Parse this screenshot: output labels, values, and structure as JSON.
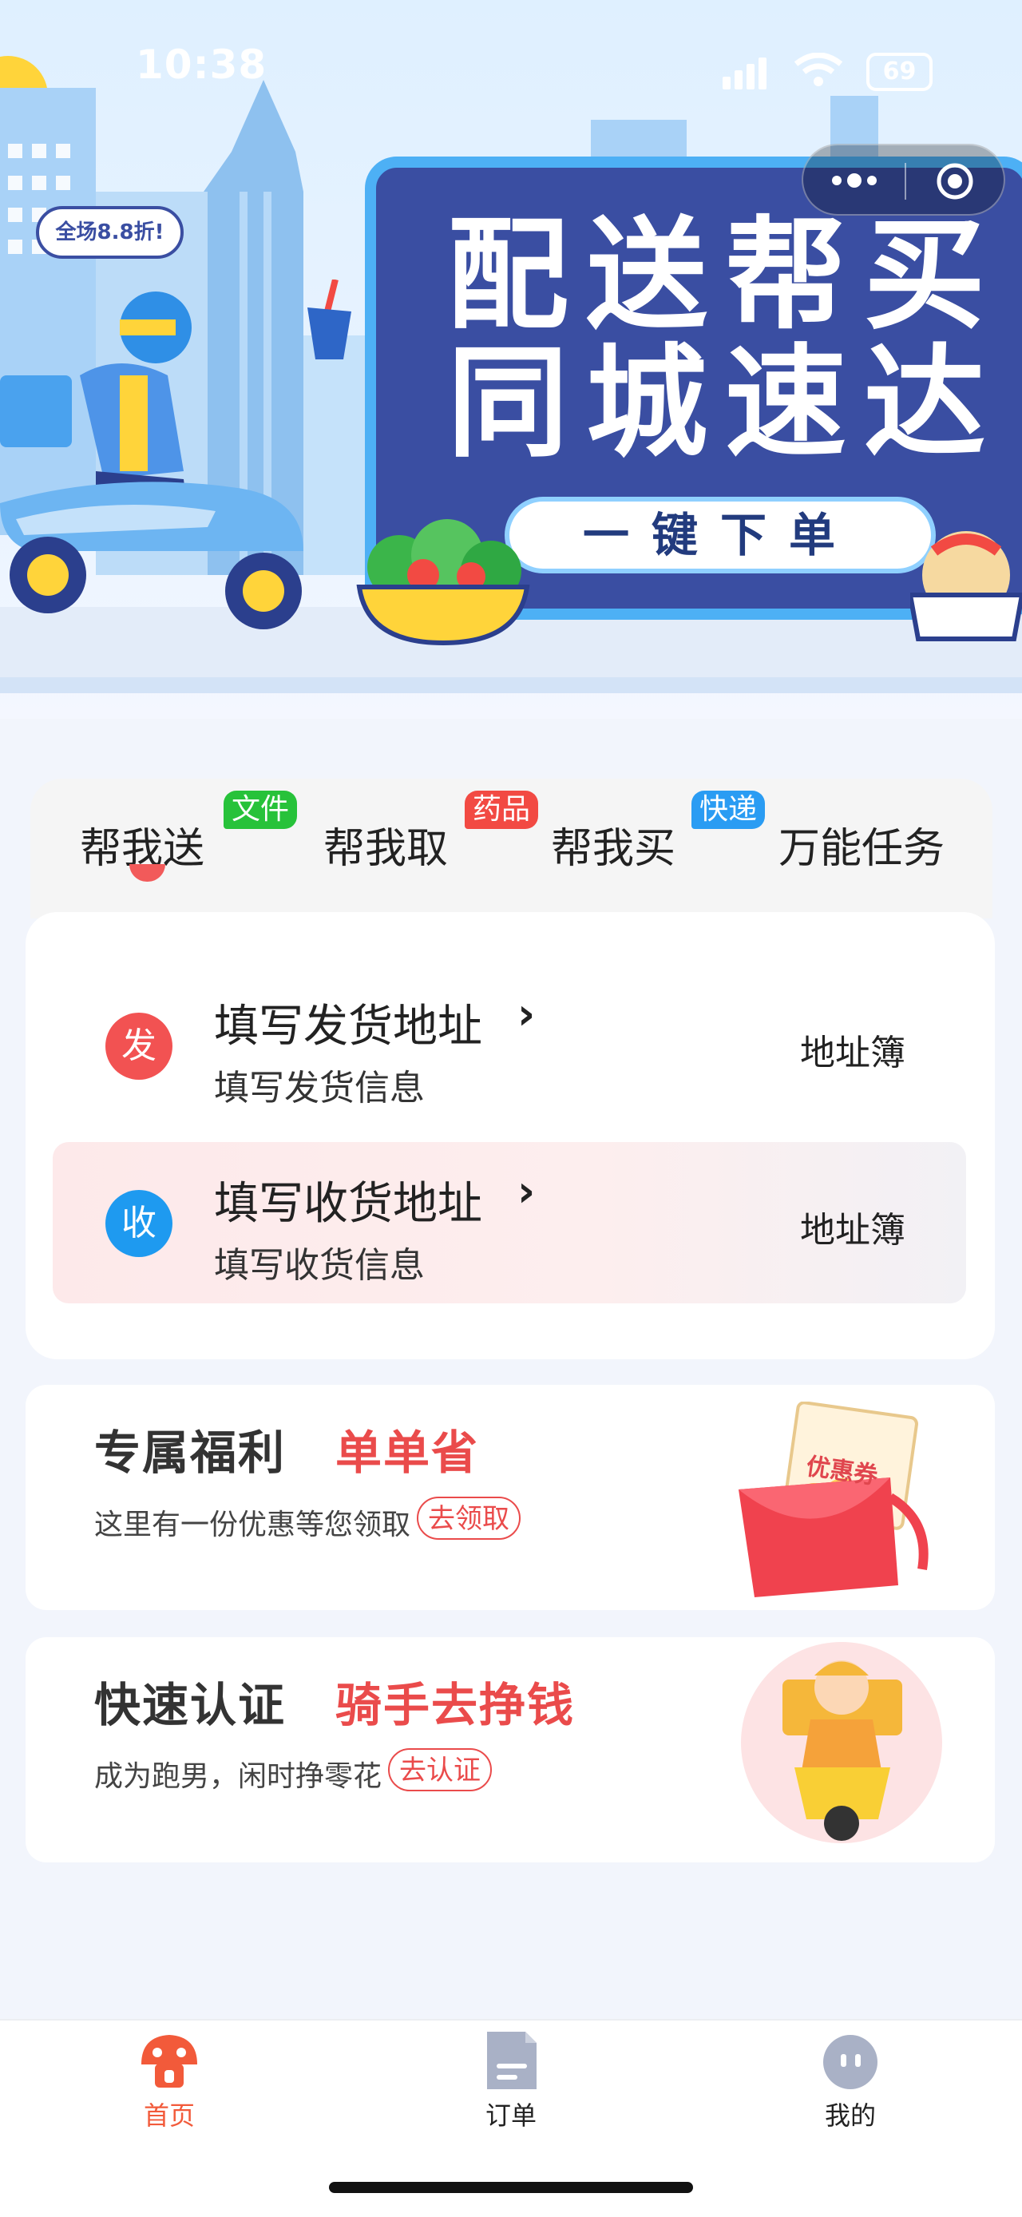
{
  "status_bar": {
    "time": "10:38",
    "battery": "69"
  },
  "banner": {
    "badge": "全场8.8折!",
    "title_line1": "配送帮买",
    "title_line2": "同城速达",
    "cta": "一键下单"
  },
  "service_tabs": [
    {
      "label": "帮我送",
      "active": true
    },
    {
      "label": "帮我取",
      "tag": "文件",
      "tag_color": "#27c23a"
    },
    {
      "label": "帮我买",
      "tag": "药品",
      "tag_color": "#f24a43"
    },
    {
      "label": "万能任务",
      "tag": "快递",
      "tag_color": "#2a9cf3"
    }
  ],
  "address": {
    "sender": {
      "badge": "发",
      "title": "填写发货地址",
      "subtitle": "填写发货信息",
      "book": "地址簿",
      "color": "#f25252"
    },
    "receiver": {
      "badge": "收",
      "title": "填写收货地址",
      "subtitle": "填写收货信息",
      "book": "地址簿",
      "color": "#1e9af0"
    }
  },
  "promos": [
    {
      "title": "专属福利",
      "highlight": "单单省",
      "subtitle": "这里有一份优惠等您领取",
      "button": "去领取",
      "image_text": "优惠券"
    },
    {
      "title": "快速认证",
      "highlight": "骑手去挣钱",
      "subtitle": "成为跑男，闲时挣零花",
      "button": "去认证"
    }
  ],
  "bottom_nav": [
    {
      "label": "首页",
      "icon": "home-mushroom-icon",
      "active": true,
      "color": "#f25a3a"
    },
    {
      "label": "订单",
      "icon": "order-document-icon",
      "active": false,
      "color": "#222222"
    },
    {
      "label": "我的",
      "icon": "profile-face-icon",
      "active": false,
      "color": "#222222"
    }
  ]
}
